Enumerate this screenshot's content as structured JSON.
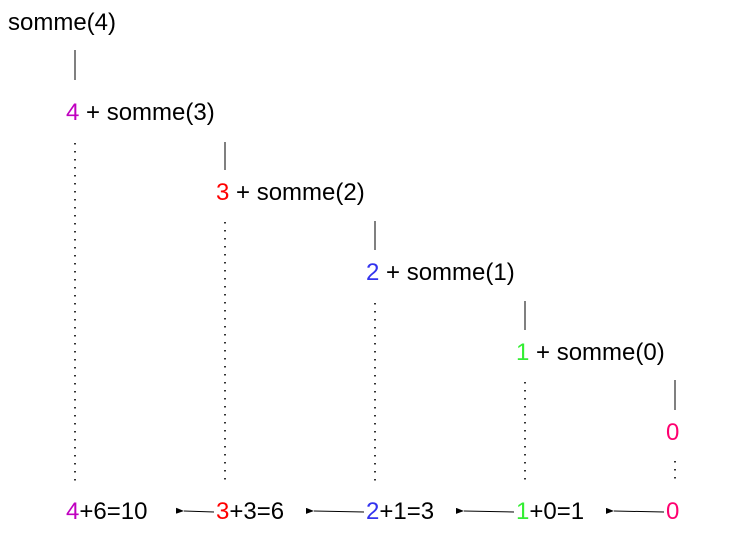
{
  "colors": {
    "magenta": "#c000c0",
    "red": "#ff0000",
    "blue": "#3333ee",
    "green": "#33ee33",
    "pink": "#ff0070",
    "black": "#000000"
  },
  "levels": [
    {
      "text": "somme(4)"
    },
    {
      "num": "4",
      "color": "magenta",
      "rest": " + somme(3)"
    },
    {
      "num": "3",
      "color": "red",
      "rest": " + somme(2)"
    },
    {
      "num": "2",
      "color": "blue",
      "rest": " + somme(1)"
    },
    {
      "num": "1",
      "color": "green",
      "rest": " + somme(0)"
    },
    {
      "num": "0",
      "color": "pink",
      "rest": ""
    }
  ],
  "results": [
    {
      "num": "4",
      "color": "magenta",
      "rest": "+6=10"
    },
    {
      "num": "3",
      "color": "red",
      "rest": "+3=6"
    },
    {
      "num": "2",
      "color": "blue",
      "rest": "+1=3"
    },
    {
      "num": "1",
      "color": "green",
      "rest": "+0=1"
    },
    {
      "num": "0",
      "color": "pink",
      "rest": ""
    }
  ]
}
